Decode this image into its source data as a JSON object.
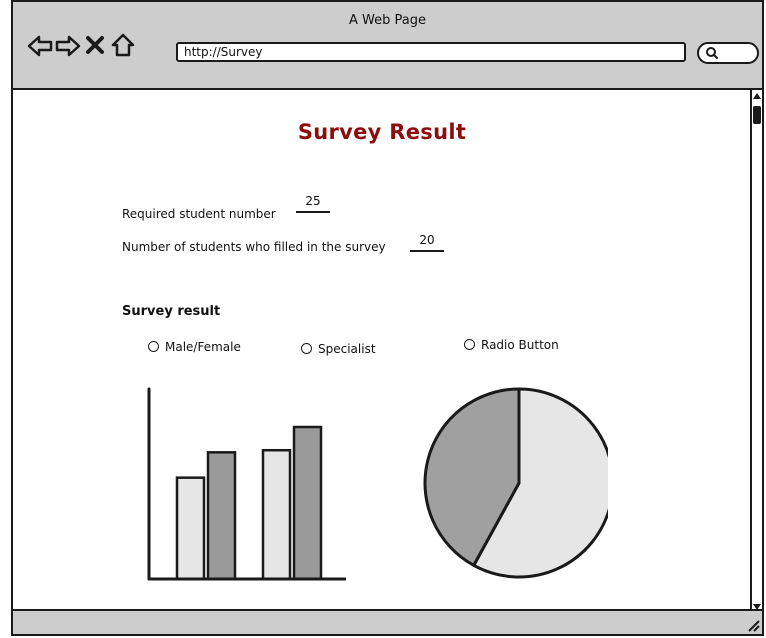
{
  "window": {
    "title": "A Web Page"
  },
  "browser": {
    "url": "http://Survey",
    "nav": [
      "back-icon",
      "forward-icon",
      "close-icon",
      "home-icon"
    ],
    "search_icon": "search-icon"
  },
  "page": {
    "title": "Survey Result",
    "fields": [
      {
        "label": "Required student number",
        "value": "25"
      },
      {
        "label": "Number of students who filled in the survey",
        "value": "20"
      }
    ],
    "section_title": "Survey result",
    "radios": [
      {
        "label": "Male/Female"
      },
      {
        "label": "Specialist"
      },
      {
        "label": "Radio Button"
      }
    ]
  },
  "chart_data": [
    {
      "type": "bar",
      "categories": [
        "",
        ""
      ],
      "series": [
        {
          "values": [
            48,
            61
          ],
          "color": "#e6e6e6"
        },
        {
          "values": [
            60,
            72
          ],
          "color": "#9a9a9a"
        }
      ],
      "ylim": [
        0,
        90
      ],
      "grid": false
    },
    {
      "type": "pie",
      "values": [
        58,
        42
      ],
      "colors": [
        "#e6e6e6",
        "#a0a0a0"
      ]
    }
  ]
}
